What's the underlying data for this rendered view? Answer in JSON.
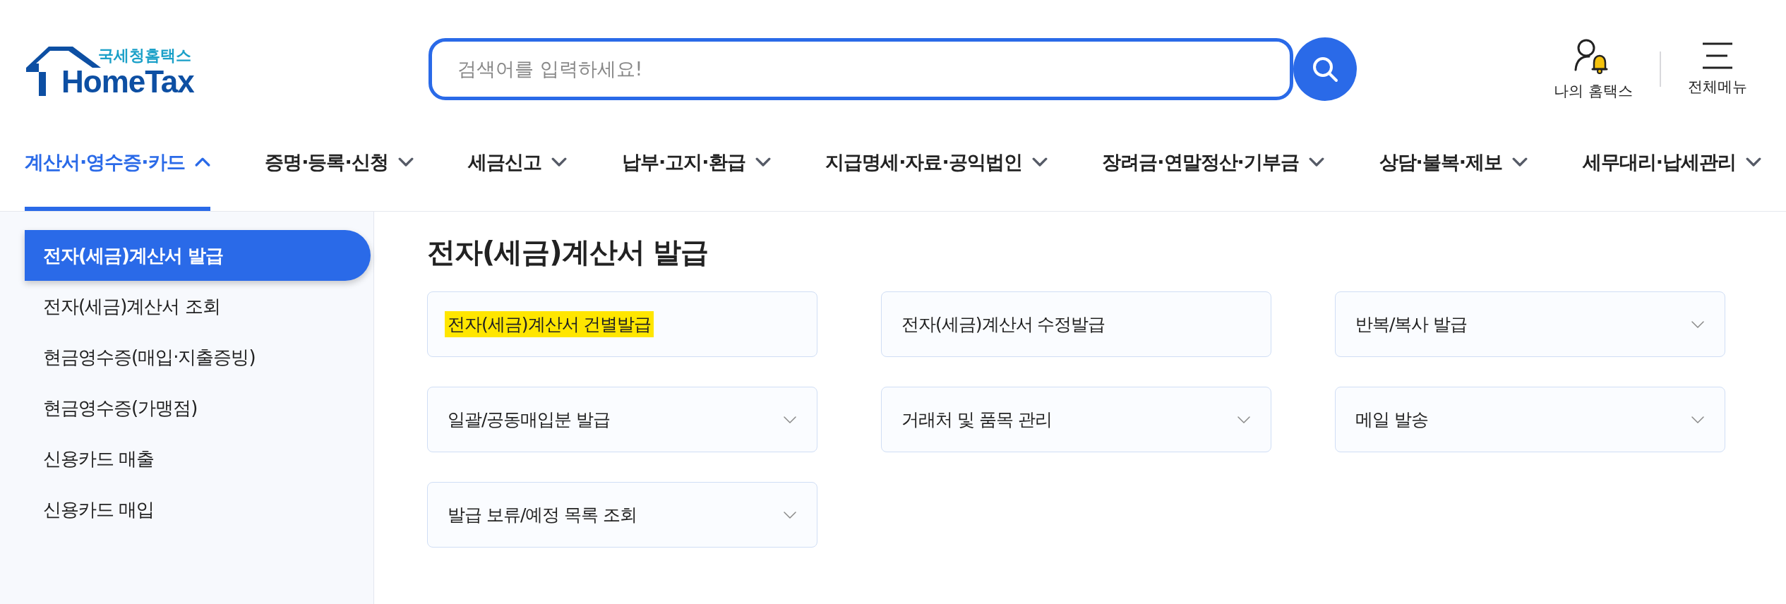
{
  "logo": {
    "subtitle": "국세청홈택스",
    "name": "HomeTax"
  },
  "search": {
    "placeholder": "검색어를 입력하세요!"
  },
  "utility": [
    {
      "kind": "account",
      "label": "나의 홈택스"
    },
    {
      "kind": "menu",
      "label": "전체메뉴"
    }
  ],
  "nav": [
    {
      "label": "계산서·영수증·카드",
      "selected": true
    },
    {
      "label": "증명·등록·신청",
      "selected": false
    },
    {
      "label": "세금신고",
      "selected": false
    },
    {
      "label": "납부·고지·환급",
      "selected": false
    },
    {
      "label": "지급명세·자료·공익법인",
      "selected": false
    },
    {
      "label": "장려금·연말정산·기부금",
      "selected": false
    },
    {
      "label": "상담·불복·제보",
      "selected": false
    },
    {
      "label": "세무대리·납세관리",
      "selected": false
    }
  ],
  "sidebar": {
    "items": [
      {
        "label": "전자(세금)계산서 발급",
        "selected": true
      },
      {
        "label": "전자(세금)계산서 조회",
        "selected": false
      },
      {
        "label": "현금영수증(매입·지출증빙)",
        "selected": false
      },
      {
        "label": "현금영수증(가맹점)",
        "selected": false
      },
      {
        "label": "신용카드 매출",
        "selected": false
      },
      {
        "label": "신용카드 매입",
        "selected": false
      }
    ]
  },
  "page_title": "전자(세금)계산서 발급",
  "cards": [
    {
      "label": "전자(세금)계산서 건별발급",
      "expandable": false,
      "highlighted": true
    },
    {
      "label": "전자(세금)계산서 수정발급",
      "expandable": false,
      "highlighted": false
    },
    {
      "label": "반복/복사 발급",
      "expandable": true,
      "highlighted": false
    },
    {
      "label": "일괄/공동매입분 발급",
      "expandable": true,
      "highlighted": false
    },
    {
      "label": "거래처 및 품목 관리",
      "expandable": true,
      "highlighted": false
    },
    {
      "label": "메일 발송",
      "expandable": true,
      "highlighted": false
    },
    {
      "label": "발급 보류/예정 목록 조회",
      "expandable": true,
      "highlighted": false
    }
  ]
}
